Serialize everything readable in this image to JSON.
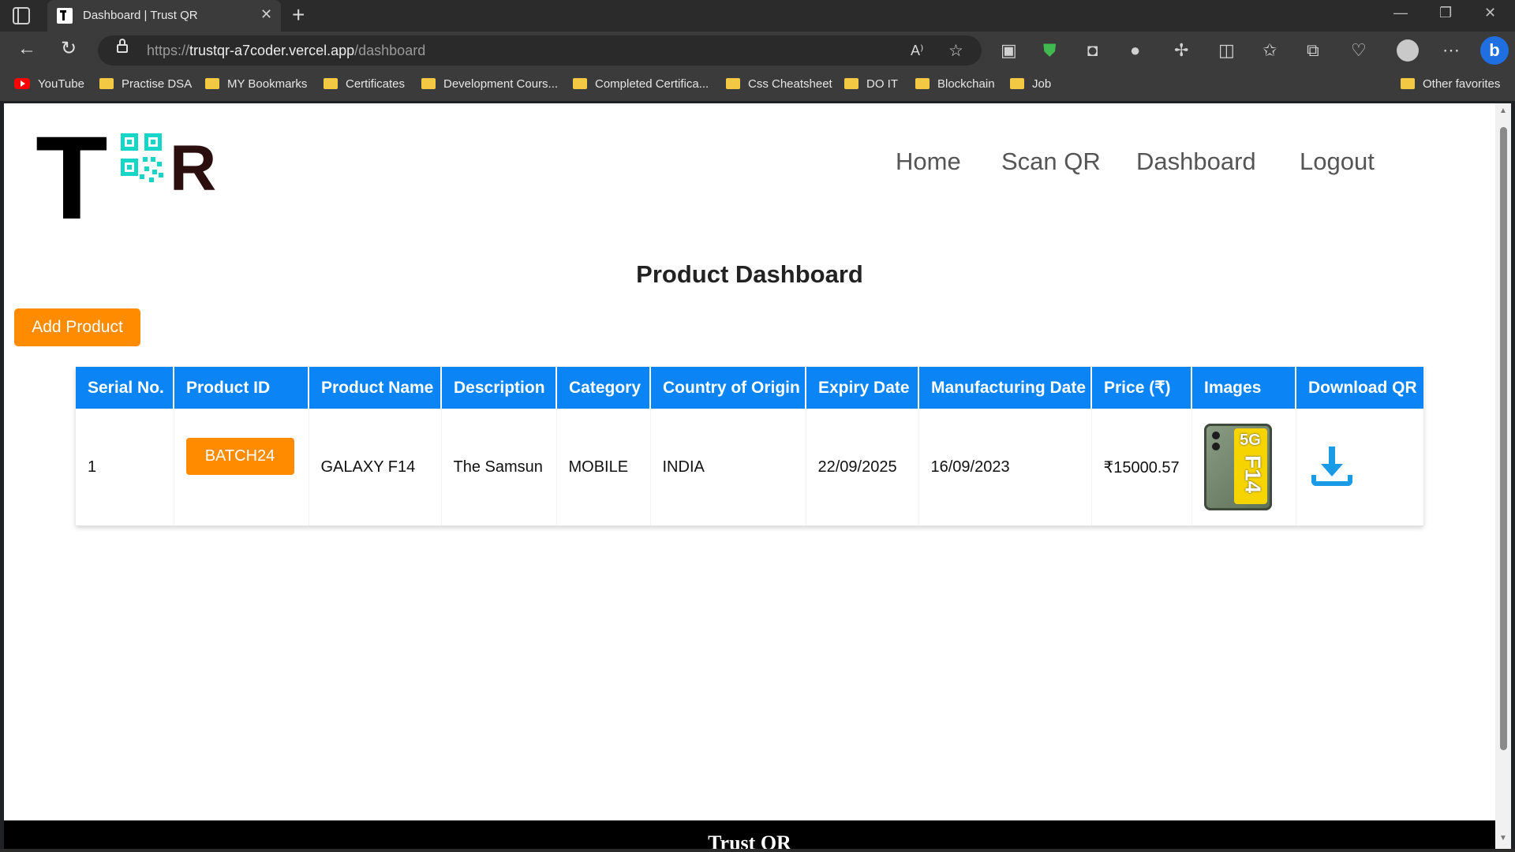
{
  "browser": {
    "tab_title": "Dashboard | Trust QR",
    "tab_close": "✕",
    "new_tab": "+",
    "url_prefix": "https://",
    "url_host": "trustqr-a7coder.vercel.app",
    "url_path": "/dashboard",
    "bookmarks": [
      {
        "label": "YouTube",
        "icon": "youtube-icon"
      },
      {
        "label": "Practise DSA",
        "icon": "folder-icon"
      },
      {
        "label": "MY Bookmarks",
        "icon": "folder-icon"
      },
      {
        "label": "Certificates",
        "icon": "folder-icon"
      },
      {
        "label": "Development Cours...",
        "icon": "folder-icon"
      },
      {
        "label": "Completed Certifica...",
        "icon": "folder-icon"
      },
      {
        "label": "Css Cheatsheet",
        "icon": "folder-icon"
      },
      {
        "label": "DO IT",
        "icon": "folder-icon"
      },
      {
        "label": "Blockchain",
        "icon": "folder-icon"
      },
      {
        "label": "Job",
        "icon": "folder-icon"
      }
    ],
    "other_favorites": "Other favorites"
  },
  "site": {
    "nav": [
      "Home",
      "Scan QR",
      "Dashboard",
      "Logout"
    ],
    "logo_letters": [
      "T",
      "R"
    ],
    "page_title": "Product Dashboard",
    "add_product_label": "Add Product",
    "footer_text": "Trust QR"
  },
  "table": {
    "headers": [
      "Serial No.",
      "Product ID",
      "Product Name",
      "Description",
      "Category",
      "Country of Origin",
      "Expiry Date",
      "Manufacturing Date",
      "Price (₹)",
      "Images",
      "Download QR"
    ],
    "rows": [
      {
        "serial": "1",
        "product_id": "BATCH24",
        "product_name": "GALAXY F14",
        "description": "The Samsun",
        "category": "MOBILE",
        "country": "INDIA",
        "expiry": "22/09/2025",
        "manufacturing": "16/09/2023",
        "price": "₹15000.57",
        "image_badge": "5G",
        "image_model": "F14"
      }
    ]
  },
  "colors": {
    "accent_orange": "#ff8c00",
    "header_blue": "#0b84f5",
    "logo_qr_teal": "#16d6c8"
  }
}
